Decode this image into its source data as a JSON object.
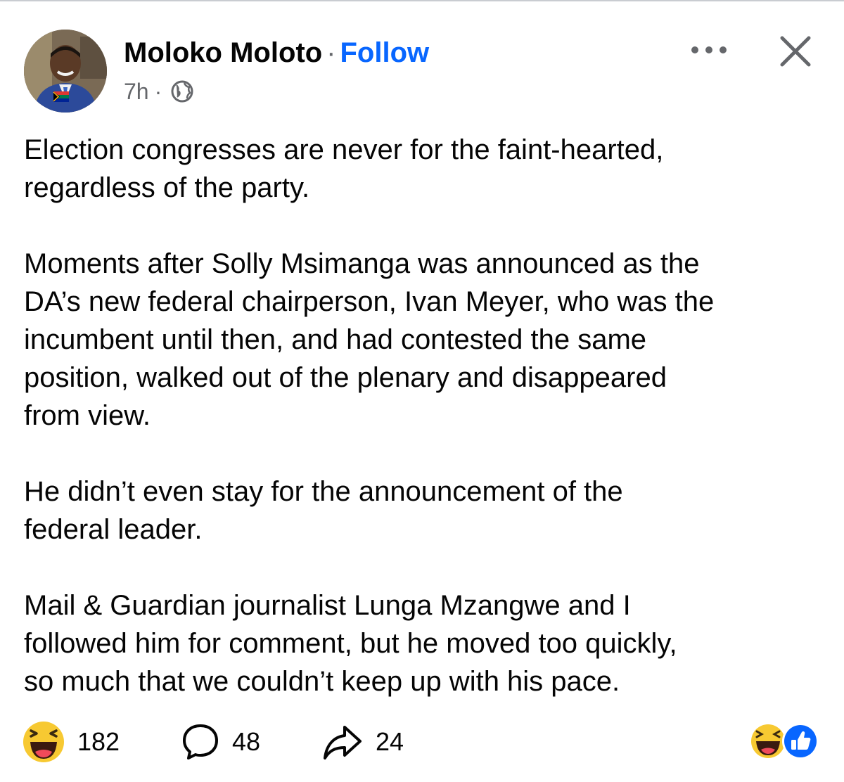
{
  "post": {
    "author_name": "Moloko Moloto",
    "separator": "·",
    "follow_label": "Follow",
    "time": "7h",
    "time_separator": "·",
    "audience_icon": "globe-icon",
    "more_icon": "more-options-icon",
    "close_icon": "close-icon",
    "paragraphs": [
      "Election congresses are never for the faint-hearted,\nregardless of the party.",
      "Moments after Solly Msimanga was announced as the\nDA’s new federal chairperson, Ivan Meyer, who was the\nincumbent until then, and had contested the same\nposition, walked out of the plenary and disappeared\nfrom view.",
      "He didn’t even stay for the announcement of the\nfederal leader.",
      "Mail & Guardian journalist Lunga Mzangwe and I\nfollowed him for comment, but he moved too quickly,\nso much that we couldn’t keep up with his pace."
    ]
  },
  "footer": {
    "reactions_count": "182",
    "comments_count": "48",
    "shares_count": "24",
    "reaction_icon": "haha-reaction-icon",
    "comment_icon": "comment-icon",
    "share_icon": "share-icon",
    "summary_icons": [
      "haha-reaction-icon",
      "like-reaction-icon"
    ]
  },
  "colors": {
    "follow": "#0866ff",
    "meta_text": "#65676b",
    "like_blue": "#0866ff",
    "haha_yellow": "#f7c932"
  }
}
